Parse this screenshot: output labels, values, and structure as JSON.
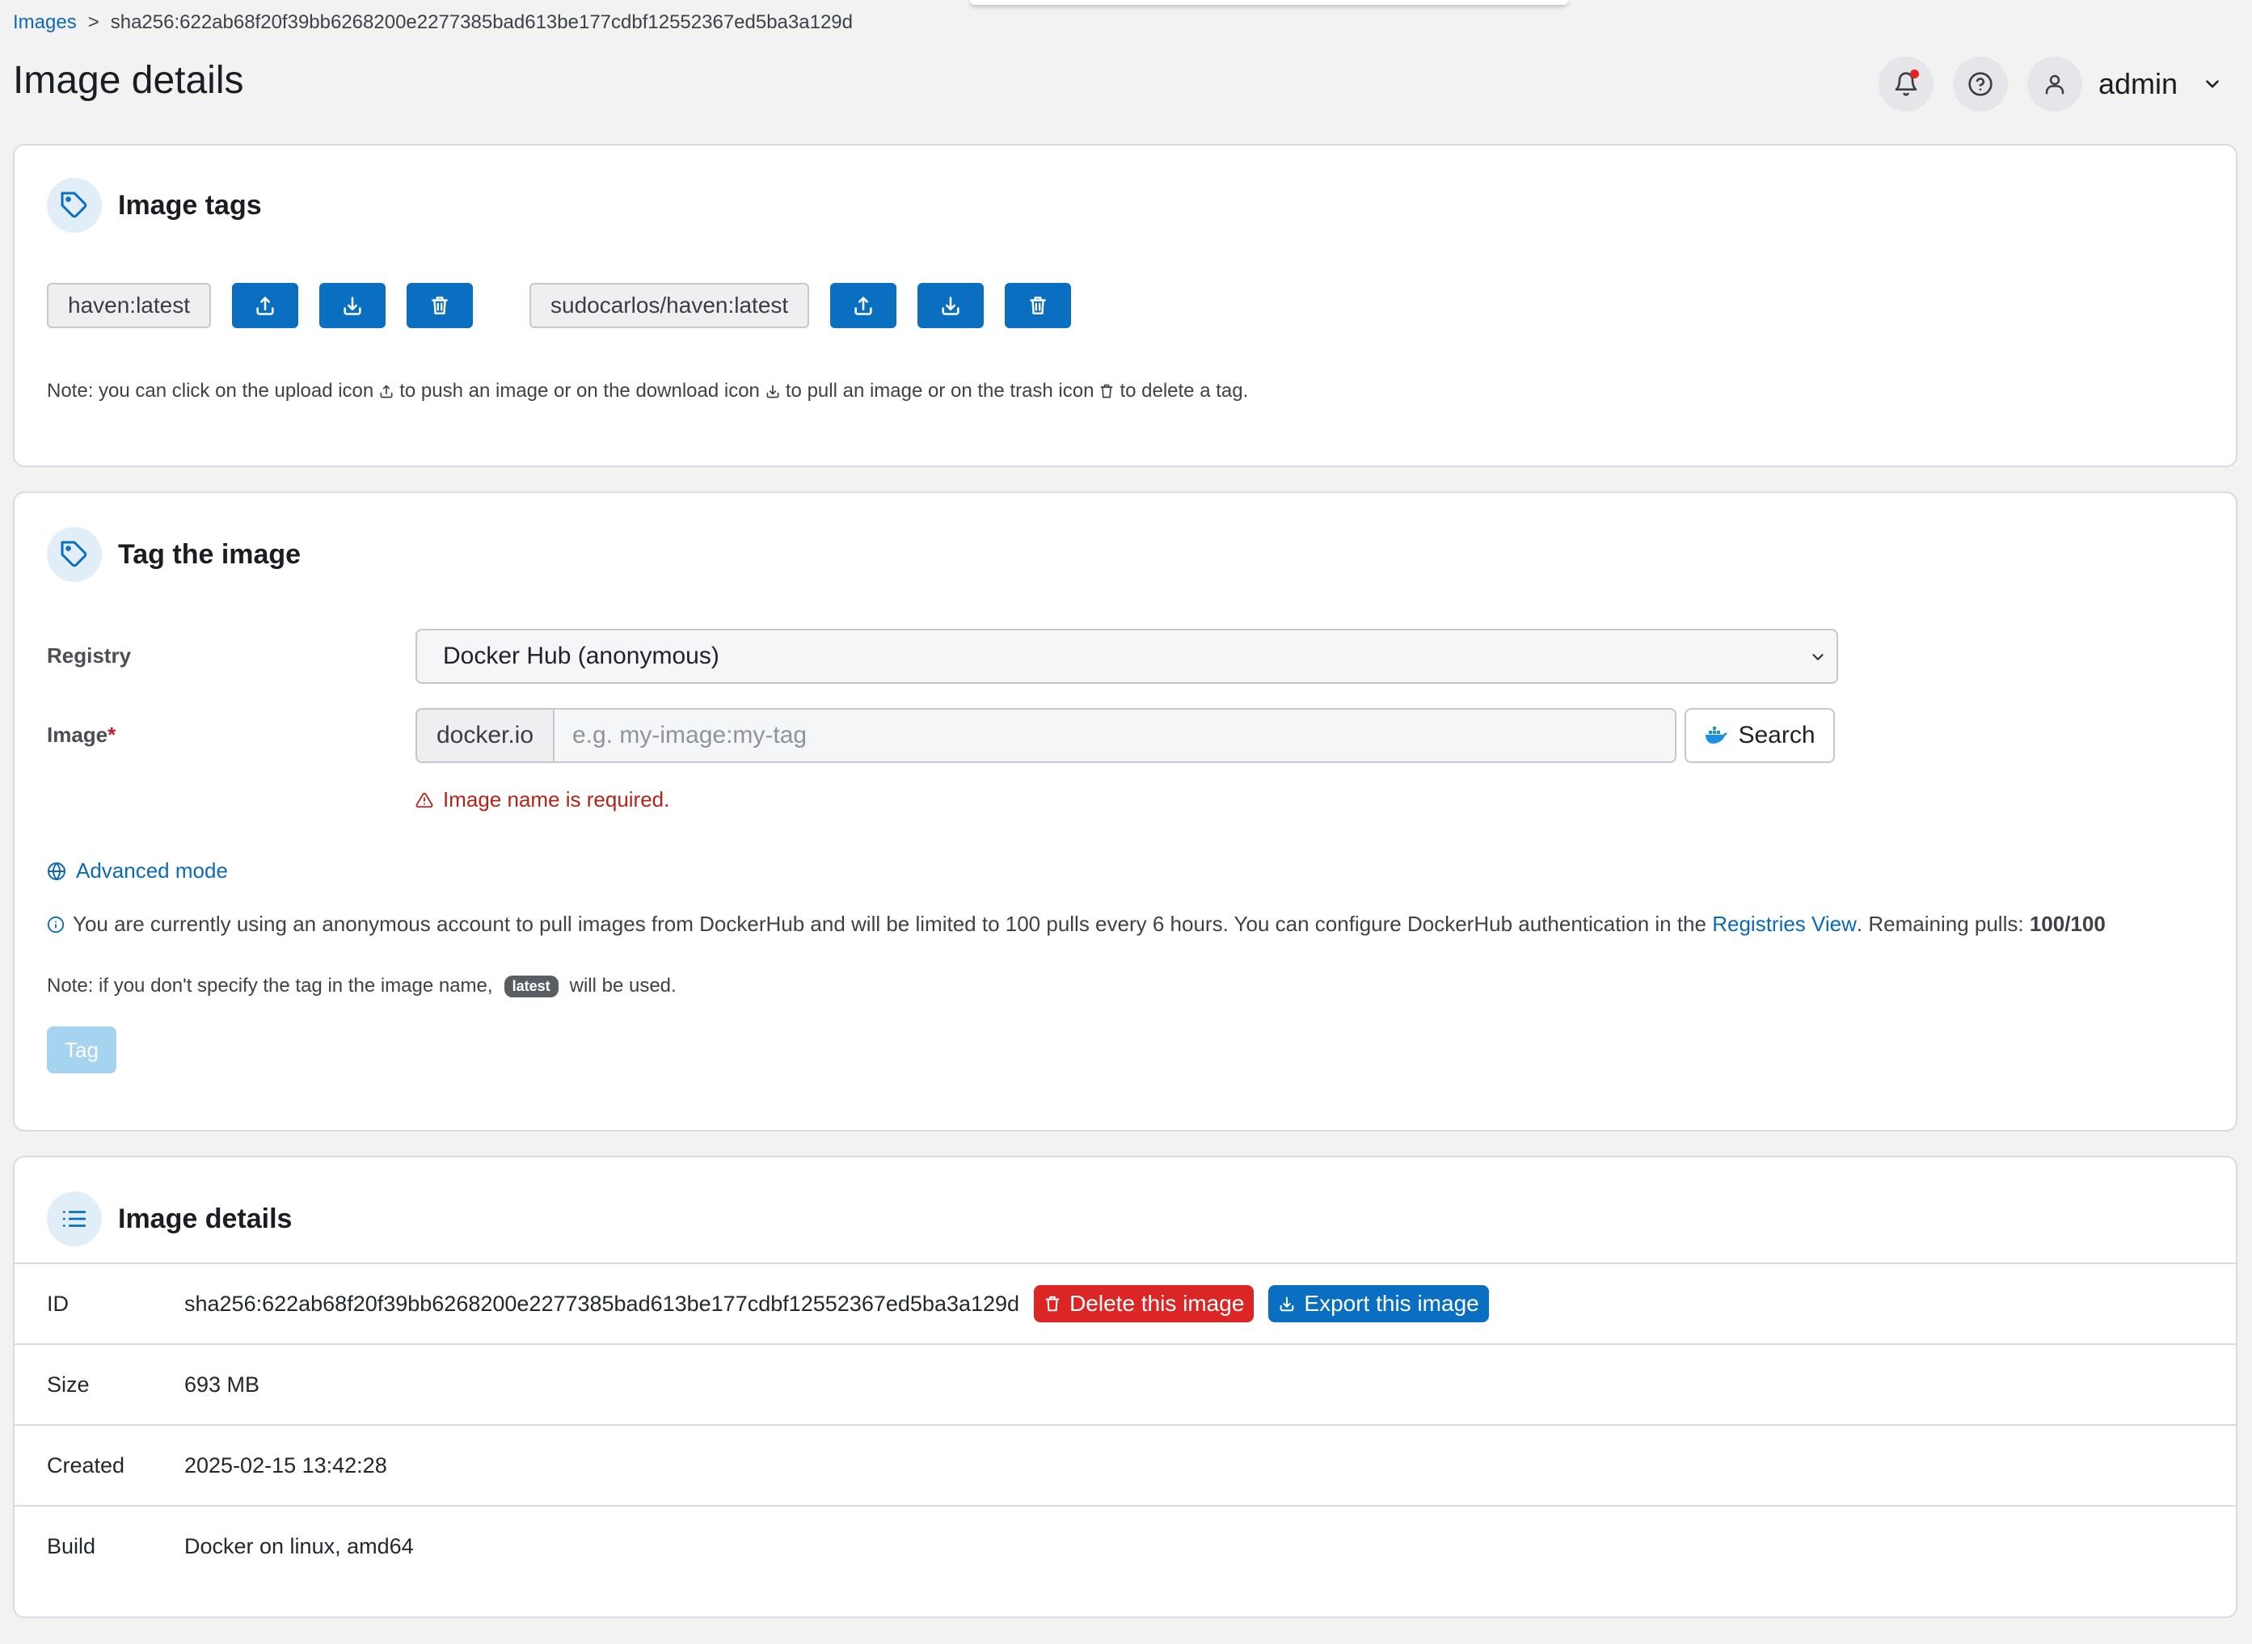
{
  "breadcrumb": {
    "root": "Images",
    "separator": ">",
    "current": "sha256:622ab68f20f39bb6268200e2277385bad613be177cdbf12552367ed5ba3a129d"
  },
  "page_title": "Image details",
  "header": {
    "user_name": "admin",
    "icons": [
      "bell-icon",
      "help-icon",
      "user-icon",
      "chevron-down-icon"
    ]
  },
  "image_tags": {
    "title": "Image tags",
    "tags": [
      {
        "name": "haven:latest"
      },
      {
        "name": "sudocarlos/haven:latest"
      }
    ],
    "note": {
      "part1": "Note: you can click on the upload icon",
      "part2": "to push an image or on the download icon",
      "part3": "to pull an image or on the trash icon",
      "part4": "to delete a tag."
    }
  },
  "tag_image": {
    "title": "Tag the image",
    "registry_label": "Registry",
    "registry_value": "Docker Hub (anonymous)",
    "image_label": "Image",
    "required_mark": "*",
    "registry_prefix": "docker.io",
    "image_placeholder": "e.g. my-image:my-tag",
    "search_label": "Search",
    "error_text": "Image name is required.",
    "advanced_mode": "Advanced mode",
    "info": {
      "text_before": "You are currently using an anonymous account to pull images from DockerHub and will be limited to 100 pulls every 6 hours. You can configure DockerHub authentication in the",
      "link": "Registries View",
      "text_after": ". Remaining pulls:",
      "remaining": "100/100"
    },
    "tag_note_before": "Note: if you don't specify the tag in the image name,",
    "tag_note_badge": "latest",
    "tag_note_after": "will be used.",
    "tag_button": "Tag"
  },
  "details": {
    "title": "Image details",
    "rows": {
      "id": {
        "label": "ID",
        "value": "sha256:622ab68f20f39bb6268200e2277385bad613be177cdbf12552367ed5ba3a129d"
      },
      "size": {
        "label": "Size",
        "value": "693 MB"
      },
      "created": {
        "label": "Created",
        "value": "2025-02-15 13:42:28"
      },
      "build": {
        "label": "Build",
        "value": "Docker on linux, amd64"
      }
    },
    "delete_button": "Delete this image",
    "export_button": "Export this image"
  },
  "colors": {
    "primary": "#0a6fc1",
    "danger": "#dc2626",
    "error_text": "#b42318",
    "link": "#0b69b6"
  }
}
